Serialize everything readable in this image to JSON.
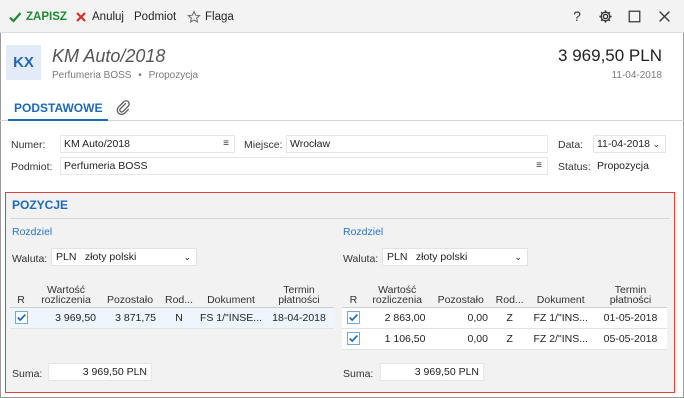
{
  "toolbar": {
    "save_label": "ZAPISZ",
    "cancel_label": "Anuluj",
    "podmiot_label": "Podmiot",
    "flag_label": "Flaga",
    "help_glyph": "?",
    "accent_green": "#1e8a32",
    "cancel_red": "#d9302b"
  },
  "header": {
    "badge": "KX",
    "title": "KM Auto/2018",
    "subtitle_company": "Perfumeria BOSS",
    "subtitle_sep": "•",
    "subtitle_status": "Propozycja",
    "amount": "3 969,50 PLN",
    "date": "11-04-2018"
  },
  "tabs": {
    "active_label": "PODSTAWOWE",
    "attachment_icon": "paperclip-icon"
  },
  "form": {
    "numer_label": "Numer:",
    "numer_value": "KM Auto/2018",
    "miejsce_label": "Miejsce:",
    "miejsce_value": "Wrocław",
    "data_label": "Data:",
    "data_value": "11-04-2018",
    "podmiot_label": "Podmiot:",
    "podmiot_value": "Perfumeria BOSS",
    "status_label": "Status:",
    "status_value": "Propozycja"
  },
  "pozycje": {
    "title": "POZYCJE",
    "highlight_color": "#e0443c",
    "left": {
      "rozdziel": "Rozdziel",
      "waluta_label": "Waluta:",
      "waluta_code": "PLN",
      "waluta_name": "złoty polski",
      "headers": [
        "R",
        "Wartość rozliczenia",
        "Pozostało",
        "Rod...",
        "Dokument",
        "Termin płatności"
      ],
      "rows": [
        {
          "checked": true,
          "wartosc": "3 969,50",
          "pozostalo": "3 871,75",
          "rod": "N",
          "dokument": "FS 1/\"INSE...",
          "termin": "18-04-2018"
        }
      ],
      "suma_label": "Suma:",
      "suma_value": "3 969,50 PLN"
    },
    "right": {
      "rozdziel": "Rozdziel",
      "waluta_label": "Waluta:",
      "waluta_code": "PLN",
      "waluta_name": "złoty polski",
      "headers": [
        "R",
        "Wartość rozliczenia",
        "Pozostało",
        "Rod...",
        "Dokument",
        "Termin płatności"
      ],
      "rows": [
        {
          "checked": true,
          "wartosc": "2 863,00",
          "pozostalo": "0,00",
          "rod": "Z",
          "dokument": "FZ 1/\"INS...",
          "termin": "01-05-2018"
        },
        {
          "checked": true,
          "wartosc": "1 106,50",
          "pozostalo": "0,00",
          "rod": "Z",
          "dokument": "FZ 2/\"INS...",
          "termin": "05-05-2018"
        }
      ],
      "suma_label": "Suma:",
      "suma_value": "3 969,50 PLN"
    }
  }
}
